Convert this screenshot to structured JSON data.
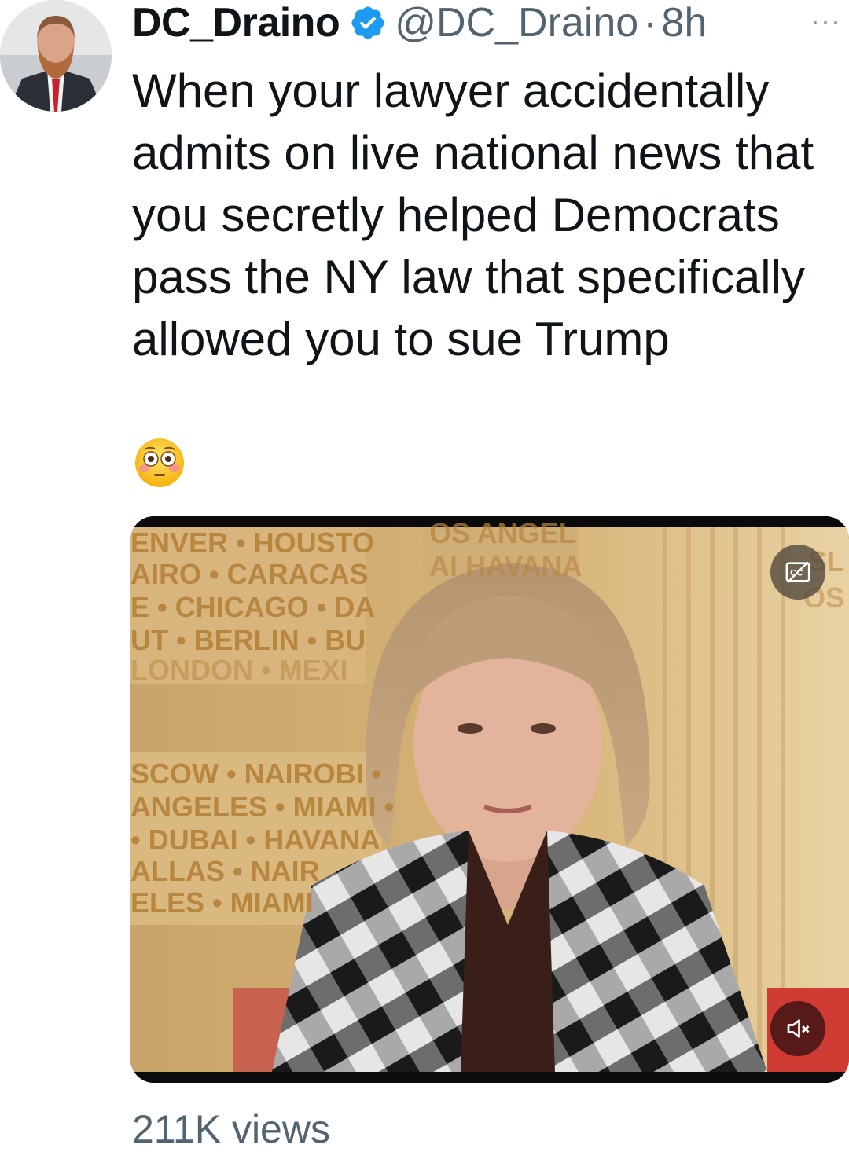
{
  "author": {
    "display_name": "DC_Draino",
    "verified_icon": "verified-badge-icon",
    "handle": "@DC_Draino",
    "separator": "·",
    "timestamp": "8h"
  },
  "more_menu": {
    "label": "···",
    "icon": "more-horizontal-icon"
  },
  "tweet": {
    "text": "When your lawyer accidentally\nadmits on live national news that\nyou secretly helped Democrats\npass the NY law that specifically\nallowed you to sue Trump",
    "emoji_icon": "flushed-face-emoji-icon"
  },
  "media": {
    "type": "video",
    "captions_icon": "closed-captions-off-icon",
    "mute_icon": "volume-muted-icon",
    "background_text": [
      "ENVER • HOUSTO",
      "AIRO • CARACAS",
      "E • CHICAGO • DA",
      "UT • BERLIN • BU",
      "LONDON • MEXI",
      "SCOW • NAIROBI •",
      "ANGELES • MIAMI •",
      "• DUBAI • HAVANA",
      "ALLAS • NAIR",
      "ELES • MIAMI",
      "OS ANGEL",
      "AI HAVANA",
      "SL",
      "OS"
    ]
  },
  "stats": {
    "views": "211K views"
  },
  "colors": {
    "text_primary": "#0f1419",
    "text_secondary": "#536471",
    "verified_blue": "#1d9bf0"
  }
}
